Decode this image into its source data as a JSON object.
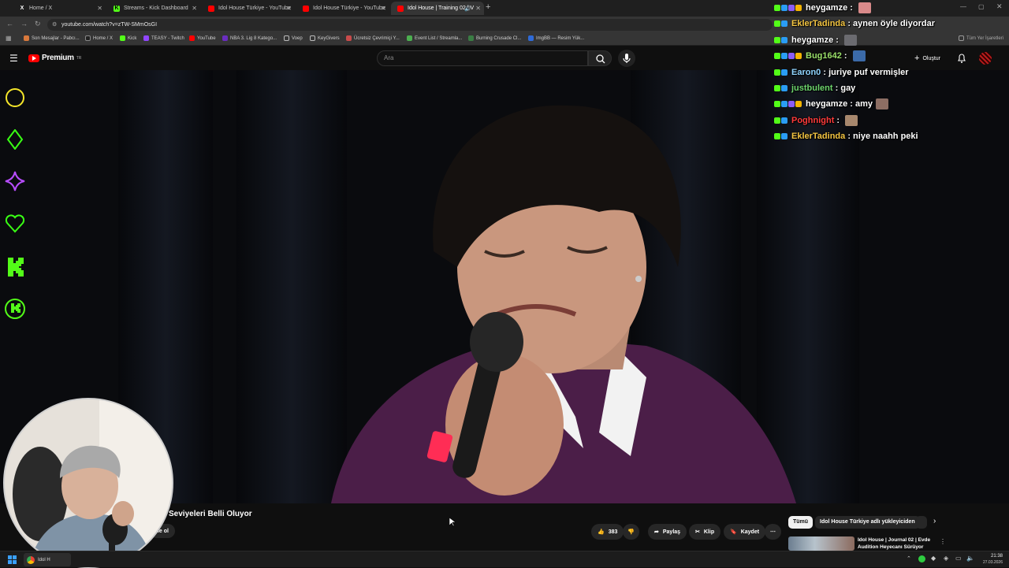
{
  "tabs": [
    {
      "label": "Home / X",
      "icon": "x-icon",
      "active": false
    },
    {
      "label": "Streams - Kick Dashboard",
      "icon": "kick-icon",
      "active": false
    },
    {
      "label": "Idol House Türkiye - YouTube",
      "icon": "youtube-icon",
      "active": false
    },
    {
      "label": "Idol House Türkiye - YouTube",
      "icon": "youtube-icon",
      "active": false
    },
    {
      "label": "Idol House | Training 02 | V",
      "icon": "youtube-icon",
      "active": true
    }
  ],
  "address": {
    "url": "youtube.com/watch?v=zTW-SMmOsGI"
  },
  "bookmarks": [
    "Son Mesajlar - Pabcı...",
    "Home / X",
    "Kick",
    "TEASY - Twitch",
    "YouTube",
    "NBA 3. Lig 8 Katego...",
    "Voep",
    "KeyGivers",
    "Ücretsiz Çevrimiçi Y...",
    "Event List / Streamla...",
    "Burning Crusade Cl...",
    "ImgBB — Resim Yük..."
  ],
  "bookmarks_right": "Tüm Yer İşaretleri",
  "youtube": {
    "logo_text": "Premium",
    "logo_sup": "TR",
    "search_placeholder": "Ara",
    "create_label": "Oluştur"
  },
  "chat": [
    {
      "user": "heygamze",
      "color": "#ffffff",
      "message": "",
      "emote": "#d98a8a"
    },
    {
      "user": "EklerTadinda",
      "color": "#f4c542",
      "message": "aynen öyle diyordar",
      "emote": ""
    },
    {
      "user": "heygamze",
      "color": "#ffffff",
      "message": "",
      "emote": "#6b6b70"
    },
    {
      "user": "Bug1642",
      "color": "#9be06a",
      "message": "",
      "emote": "#3b6aa8"
    },
    {
      "user": "Earon0",
      "color": "#8fd3ff",
      "message": "juriye puf vermişler",
      "emote": ""
    },
    {
      "user": "justbulent",
      "color": "#6dd46d",
      "message": "gay",
      "emote": ""
    },
    {
      "user": "heygamze",
      "color": "#ffffff",
      "message": "amy",
      "emote": "#8d6e63"
    },
    {
      "user": "Poghnight",
      "color": "#ff3b3b",
      "message": "",
      "emote": "#a7876d"
    },
    {
      "user": "EklerTadinda",
      "color": "#f4c542",
      "message": "niye naahh peki",
      "emote": ""
    }
  ],
  "video": {
    "title": "Seviyeleri Belli Oluyor",
    "subscribe_label": "ile ol",
    "like_count": "383",
    "share_label": "Paylaş",
    "clip_label": "Klip",
    "save_label": "Kaydet"
  },
  "sidebar_chips": {
    "all_label": "Tümü",
    "channel_label": "Idol House Türkiye adlı yükleyiciden"
  },
  "recommendation": {
    "title": "Idol House | Journal 02 | Evde Audition Heyecanı Sürüyor"
  },
  "taskbar": {
    "app_label": "Idol H",
    "time": "21:38",
    "date": "27.03.2026"
  },
  "colors": {
    "neon_yellow": "#f5e62a",
    "neon_green": "#39ff14",
    "neon_purple": "#b84dff",
    "kick_green": "#53fc18",
    "youtube_red": "#ff0000"
  }
}
